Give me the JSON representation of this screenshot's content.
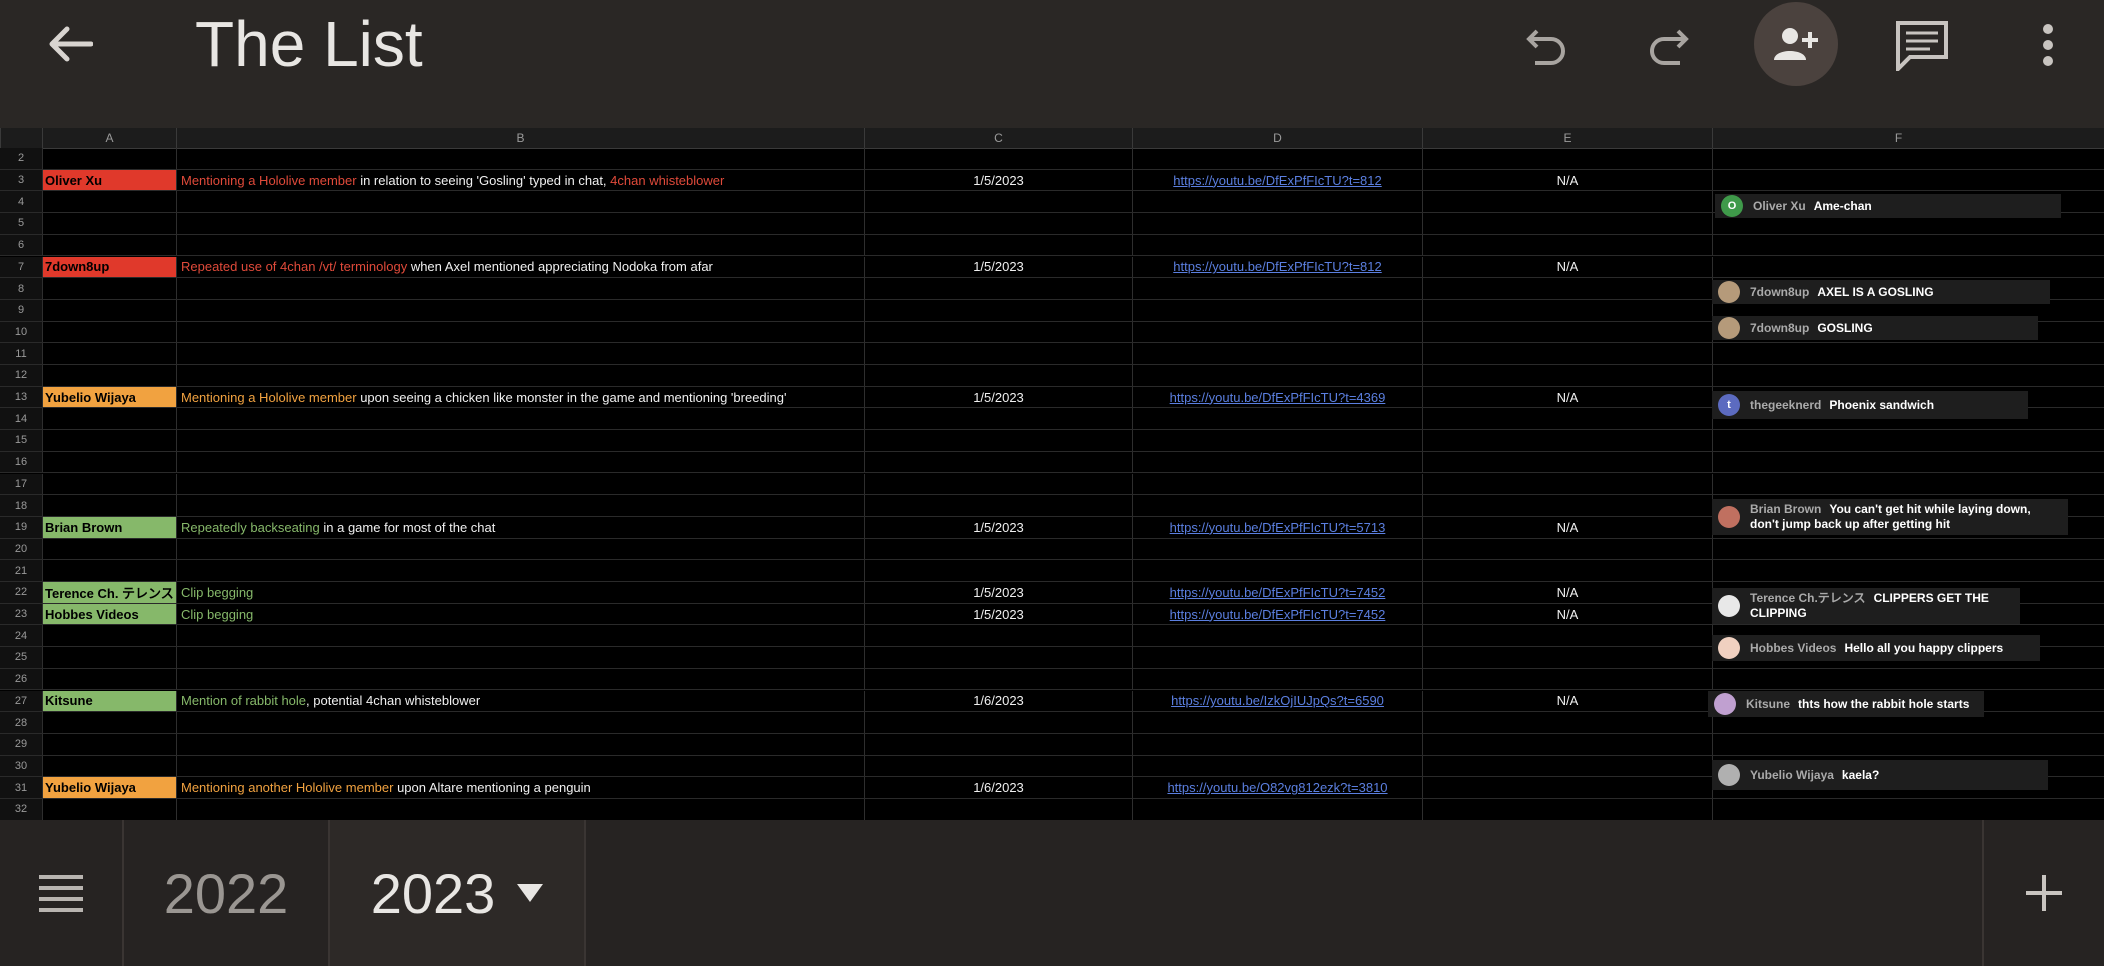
{
  "appbar": {
    "title": "The List"
  },
  "columns": [
    "A",
    "B",
    "C",
    "D",
    "E",
    "F"
  ],
  "row_numbers": [
    "2",
    "3",
    "4",
    "5",
    "6",
    "7",
    "8",
    "9",
    "10",
    "11",
    "12",
    "13",
    "14",
    "15",
    "16",
    "17",
    "18",
    "19",
    "20",
    "21",
    "22",
    "23",
    "24",
    "25",
    "26",
    "27",
    "28",
    "29",
    "30",
    "31",
    "32"
  ],
  "entries": [
    {
      "name": "Oliver Xu",
      "color": "#e0392b",
      "reason_highlight": "Mentioning a Hololive member",
      "reason_rest": " in relation to seeing 'Gosling' typed in chat, ",
      "reason_extra": "4chan whisteblower",
      "date": "1/5/2023",
      "link": "https://youtu.be/DfExPfFIcTU?t=812",
      "status": "N/A"
    },
    {
      "name": "7down8up",
      "color": "#e0392b",
      "reason_highlight": "Repeated use of 4chan /vt/ terminology",
      "reason_rest": " when Axel mentioned appreciating Nodoka from afar",
      "reason_extra": "",
      "date": "1/5/2023",
      "link": "https://youtu.be/DfExPfFIcTU?t=812",
      "status": "N/A"
    },
    {
      "name": "Yubelio Wijaya",
      "color": "#f1a240",
      "reason_highlight": "Mentioning a Hololive member",
      "reason_rest": " upon seeing a chicken like monster in the game and mentioning 'breeding'",
      "reason_extra": "",
      "date": "1/5/2023",
      "link": "https://youtu.be/DfExPfFIcTU?t=4369",
      "status": "N/A"
    },
    {
      "name": "Brian Brown",
      "color": "#86b86a",
      "reason_highlight": "Repeatedly backseating",
      "reason_rest": " in a game for most of the chat",
      "reason_extra": "",
      "date": "1/5/2023",
      "link": "https://youtu.be/DfExPfFIcTU?t=5713",
      "status": "N/A"
    },
    {
      "name": "Terence Ch. テレンス",
      "color": "#86b86a",
      "reason_highlight": "Clip begging",
      "reason_rest": "",
      "reason_extra": "",
      "date": "1/5/2023",
      "link": "https://youtu.be/DfExPfFIcTU?t=7452",
      "status": "N/A"
    },
    {
      "name": "Hobbes Videos",
      "color": "#86b86a",
      "reason_highlight": "Clip begging",
      "reason_rest": "",
      "reason_extra": "",
      "date": "1/5/2023",
      "link": "https://youtu.be/DfExPfFIcTU?t=7452",
      "status": "N/A"
    },
    {
      "name": "Kitsune",
      "color": "#86b86a",
      "reason_highlight": "Mention of rabbit hole",
      "reason_rest": ", potential 4chan whisteblower",
      "reason_extra": "",
      "date": "1/6/2023",
      "link": "https://youtu.be/IzkOjIUJpQs?t=6590",
      "status": "N/A"
    },
    {
      "name": "Yubelio Wijaya",
      "color": "#f1a240",
      "reason_highlight": "Mentioning another Hololive member",
      "reason_rest": " upon Altare mentioning a penguin",
      "reason_extra": "",
      "date": "1/6/2023",
      "link": "https://youtu.be/O82vg812ezk?t=3810",
      "status": ""
    }
  ],
  "chats": [
    {
      "name": "Oliver Xu",
      "msg": "Ame-chan",
      "avatar": "O",
      "avatar_color": "#3f9a4a"
    },
    {
      "name": "7down8up",
      "msg": "AXEL IS A GOSLING",
      "avatar": "",
      "avatar_color": "#b59a7a"
    },
    {
      "name": "7down8up",
      "msg": "GOSLING",
      "avatar": "",
      "avatar_color": "#b59a7a"
    },
    {
      "name": "thegeeknerd",
      "msg": "Phoenix sandwich",
      "avatar": "t",
      "avatar_color": "#5c6bc0"
    },
    {
      "name": "Brian Brown",
      "msg": "You can't get hit while laying down,",
      "msg2": "don't jump back up after getting hit",
      "avatar": "",
      "avatar_color": "#c07060"
    },
    {
      "name": "Terence Ch.テレンス",
      "msg": "CLIPPERS GET THE",
      "msg2": "CLIPPING",
      "avatar": "",
      "avatar_color": "#e8e8e8"
    },
    {
      "name": "Hobbes Videos",
      "msg": "Hello all you happy clippers",
      "avatar": "",
      "avatar_color": "#f0d0c0"
    },
    {
      "name": "Kitsune",
      "msg": "thts how the rabbit hole starts",
      "avatar": "",
      "avatar_color": "#c0a0d0"
    },
    {
      "name": "Yubelio Wijaya",
      "msg": "kaela?",
      "avatar": "",
      "avatar_color": "#b0b0b0"
    }
  ],
  "sheets": {
    "tab1": "2022",
    "tab2": "2023"
  }
}
